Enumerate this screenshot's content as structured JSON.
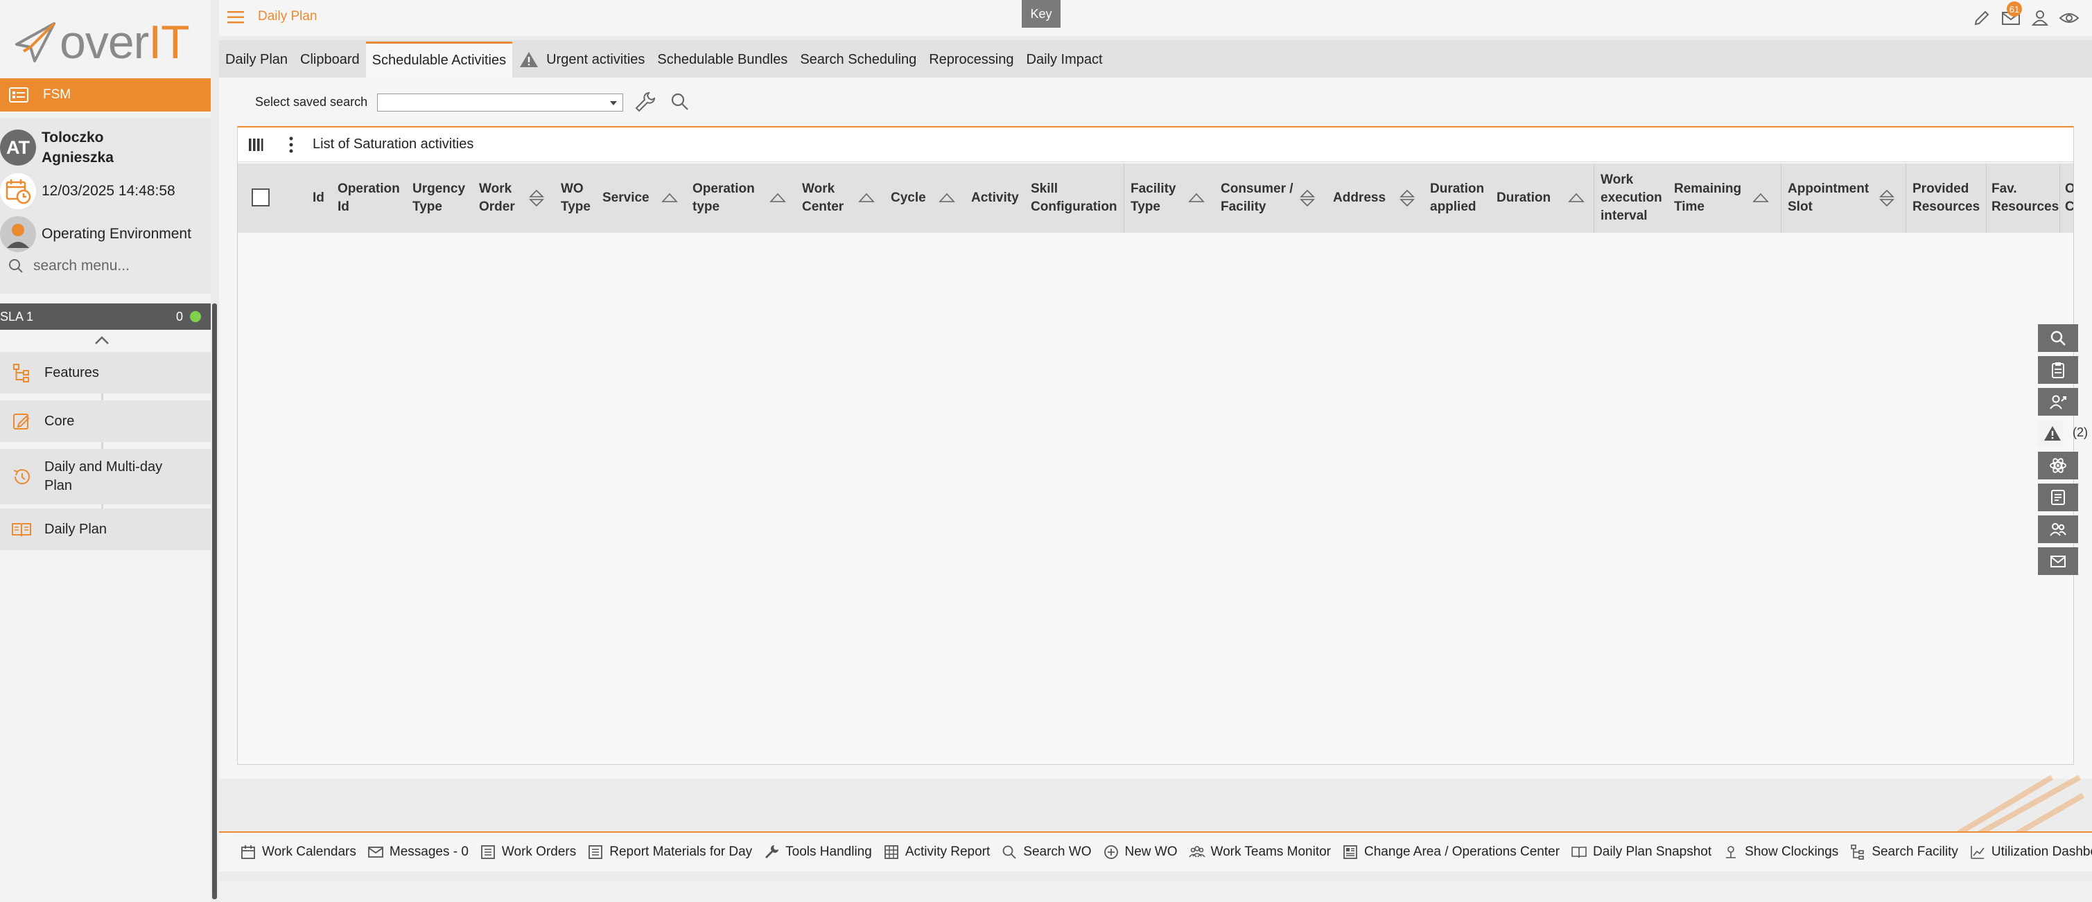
{
  "brand": {
    "logo_text_main": "over",
    "logo_text_accent": "IT"
  },
  "app": {
    "module": "FSM"
  },
  "user": {
    "initials": "AT",
    "name_line1": "Toloczko",
    "name_line2": "Agnieszka",
    "datetime": "12/03/2025 14:48:58",
    "environment": "Operating Environment"
  },
  "sidebar": {
    "search_placeholder": "search menu...",
    "sla": {
      "label": "SLA 1",
      "count": "0",
      "status_color": "#7ed34b"
    },
    "items": [
      {
        "label": "Features",
        "icon": "features-tree-icon"
      },
      {
        "label": "Core",
        "icon": "core-edit-icon"
      },
      {
        "label": "Daily and Multi-day Plan",
        "icon": "history-icon"
      },
      {
        "label": "Daily Plan",
        "icon": "book-icon"
      }
    ]
  },
  "header": {
    "title": "Daily Plan",
    "key_label": "Key",
    "messages_badge": "61",
    "icons": [
      "pencil-icon",
      "mail-icon",
      "user-icon",
      "eye-icon"
    ]
  },
  "tabs": [
    {
      "label": "Daily Plan",
      "active": false
    },
    {
      "label": "Clipboard",
      "active": false
    },
    {
      "label": "Schedulable Activities",
      "active": true
    },
    {
      "label": "Urgent activities",
      "active": false,
      "icon": "warning-icon"
    },
    {
      "label": "Schedulable Bundles",
      "active": false
    },
    {
      "label": "Search Scheduling",
      "active": false
    },
    {
      "label": "Reprocessing",
      "active": false
    },
    {
      "label": "Daily Impact",
      "active": false
    }
  ],
  "search": {
    "label": "Select saved search",
    "value": ""
  },
  "grid": {
    "title": "List of Saturation activities",
    "columns": [
      {
        "label": "Id",
        "sort": "none"
      },
      {
        "label": "Operation Id",
        "sort": "none"
      },
      {
        "label": "Urgency Type",
        "sort": "none"
      },
      {
        "label": "Work Order",
        "sort": "both"
      },
      {
        "label": "WO Type",
        "sort": "none"
      },
      {
        "label": "Service",
        "sort": "up"
      },
      {
        "label": "Operation type",
        "sort": "up"
      },
      {
        "label": "Work Center",
        "sort": "up"
      },
      {
        "label": "Cycle",
        "sort": "up"
      },
      {
        "label": "Activity",
        "sort": "none"
      },
      {
        "label": "Skill Configuration",
        "sort": "none"
      },
      {
        "label": "Facility Type",
        "sort": "up"
      },
      {
        "label": "Consumer / Facility",
        "sort": "both"
      },
      {
        "label": "Address",
        "sort": "both"
      },
      {
        "label": "Duration applied",
        "sort": "none"
      },
      {
        "label": "Duration",
        "sort": "up"
      },
      {
        "label": "Work execution interval",
        "sort": "none"
      },
      {
        "label": "Remaining Time",
        "sort": "up"
      },
      {
        "label": "Appointment Slot",
        "sort": "both"
      },
      {
        "label": "Provided Resources",
        "sort": "none"
      },
      {
        "label": "Fav. Resources",
        "sort": "none"
      },
      {
        "label": "O C",
        "sort": "none"
      }
    ],
    "rows": []
  },
  "floating_tools": [
    {
      "icon": "search-icon"
    },
    {
      "icon": "clipboard-icon"
    },
    {
      "icon": "assign-user-icon"
    },
    {
      "icon": "warning-icon",
      "count": "(2)"
    },
    {
      "icon": "atom-icon"
    },
    {
      "icon": "report-icon"
    },
    {
      "icon": "team-icon"
    },
    {
      "icon": "mail-icon"
    }
  ],
  "bottom_bar": [
    {
      "label": "Work Calendars",
      "icon": "calendar-icon"
    },
    {
      "label": "Messages - 0",
      "icon": "mail-icon"
    },
    {
      "label": "Work Orders",
      "icon": "list-icon"
    },
    {
      "label": "Report Materials for Day",
      "icon": "list-icon"
    },
    {
      "label": "Tools Handling",
      "icon": "wrench-icon"
    },
    {
      "label": "Activity Report",
      "icon": "table-icon"
    },
    {
      "label": "Search WO",
      "icon": "search-icon"
    },
    {
      "label": "New WO",
      "icon": "plus-circle-icon"
    },
    {
      "label": "Work Teams Monitor",
      "icon": "team-icon"
    },
    {
      "label": "Change Area / Operations Center",
      "icon": "area-icon"
    },
    {
      "label": "Daily Plan Snapshot",
      "icon": "book-icon"
    },
    {
      "label": "Show Clockings",
      "icon": "clock-user-icon"
    },
    {
      "label": "Search Facility",
      "icon": "features-tree-icon"
    },
    {
      "label": "Utilization Dashboard",
      "icon": "chart-icon"
    }
  ],
  "colors": {
    "accent": "#ec8a2f",
    "sidebar_bg": "#f3f3f3",
    "dark_tool": "#6e6e6e"
  }
}
